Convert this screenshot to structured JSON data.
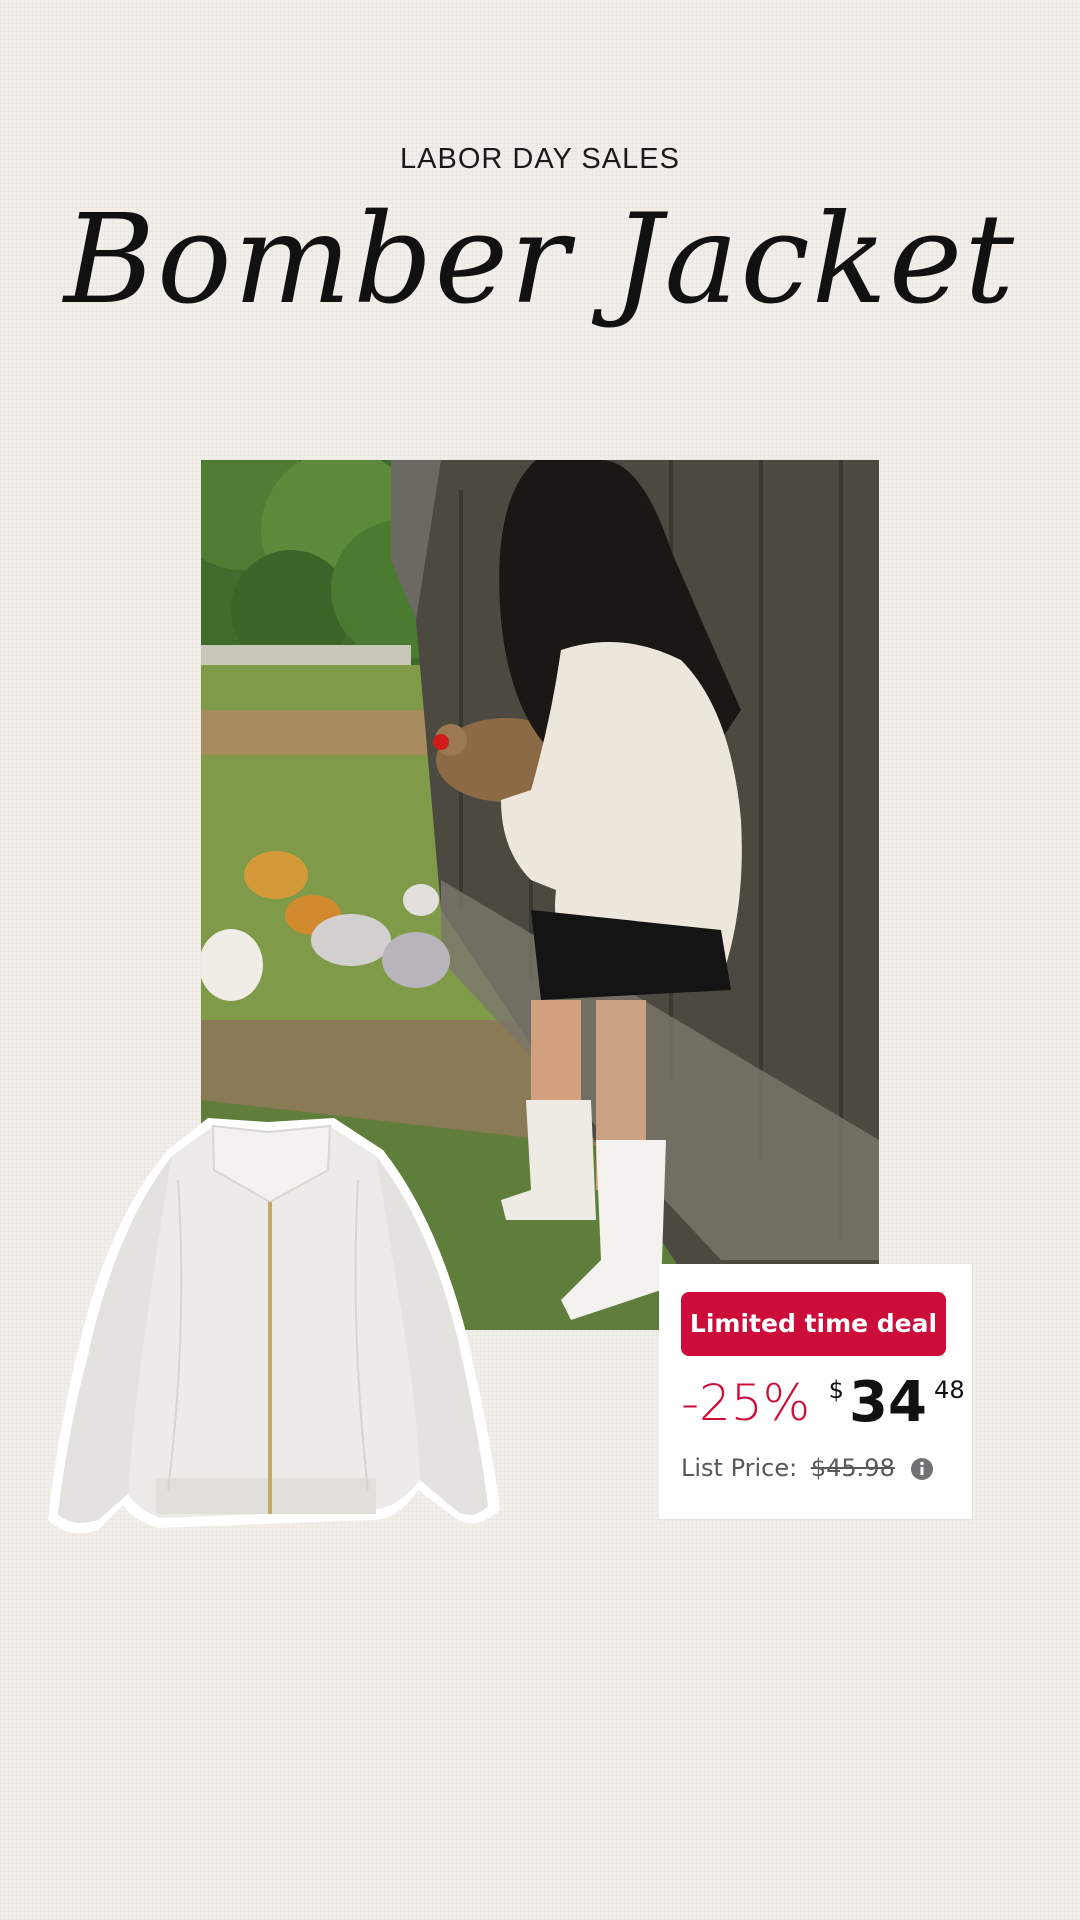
{
  "header": {
    "kicker": "LABOR DAY SALES",
    "title": "Bomber Jacket"
  },
  "photo": {
    "subject": "lifestyle-photo"
  },
  "product": {
    "subject": "product-cutout"
  },
  "deal": {
    "badge": "Limited time deal",
    "discount": "-25%",
    "currency": "$",
    "price_whole": "34",
    "price_fraction": "48",
    "list_label": "List Price:",
    "list_price": "$45.98",
    "badge_color": "#cc0c39",
    "icon": "info-icon"
  }
}
